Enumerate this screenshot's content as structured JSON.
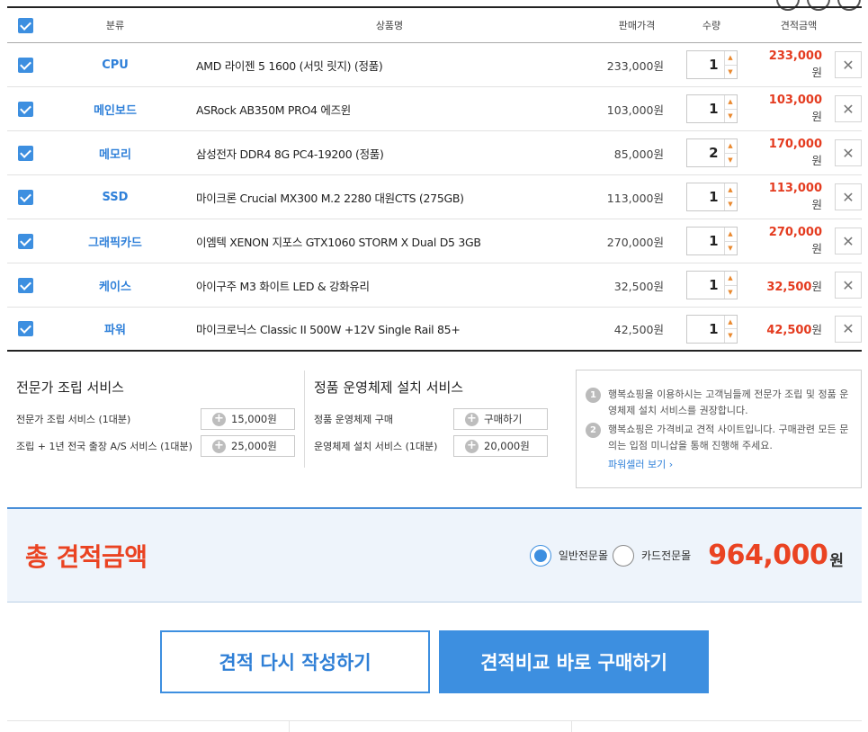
{
  "headers": {
    "category": "분류",
    "name": "상품명",
    "price": "판매가격",
    "qty": "수량",
    "total": "견적금액"
  },
  "items": [
    {
      "category": "CPU",
      "name": "AMD 라이젠 5 1600 (서밋 릿지) (정품)",
      "price": "233,000원",
      "qty": "1",
      "total": "233,000",
      "unit": "원"
    },
    {
      "category": "메인보드",
      "name": "ASRock AB350M PRO4 에즈윈",
      "price": "103,000원",
      "qty": "1",
      "total": "103,000",
      "unit": "원"
    },
    {
      "category": "메모리",
      "name": "삼성전자 DDR4 8G PC4-19200 (정품)",
      "price": "85,000원",
      "qty": "2",
      "total": "170,000",
      "unit": "원"
    },
    {
      "category": "SSD",
      "name": "마이크론 Crucial MX300 M.2 2280 대원CTS (275GB)",
      "price": "113,000원",
      "qty": "1",
      "total": "113,000",
      "unit": "원"
    },
    {
      "category": "그래픽카드",
      "name": "이엠텍 XENON 지포스 GTX1060 STORM X Dual D5 3GB",
      "price": "270,000원",
      "qty": "1",
      "total": "270,000",
      "unit": "원"
    },
    {
      "category": "케이스",
      "name": "아이구주 M3 화이트 LED & 강화유리",
      "price": "32,500원",
      "qty": "1",
      "total": "32,500",
      "unit": "원"
    },
    {
      "category": "파워",
      "name": "마이크로닉스 Classic II 500W +12V Single Rail 85+",
      "price": "42,500원",
      "qty": "1",
      "total": "42,500",
      "unit": "원"
    }
  ],
  "assembly": {
    "title": "전문가 조립 서비스",
    "rows": [
      {
        "label": "전문가 조립 서비스 (1대분)",
        "button": "15,000원"
      },
      {
        "label": "조립 + 1년 전국 출장 A/S 서비스 (1대분)",
        "button": "25,000원"
      }
    ]
  },
  "os": {
    "title": "정품 운영체제 설치 서비스",
    "rows": [
      {
        "label": "정품 운영체제 구매",
        "button": "구매하기"
      },
      {
        "label": "운영체제 설치 서비스 (1대분)",
        "button": "20,000원"
      }
    ]
  },
  "notice": {
    "items": [
      {
        "num": "1",
        "text": "행복쇼핑을 이용하시는 고객님들께 전문가 조립 및 정품 운영체제 설치 서비스를 권장합니다."
      },
      {
        "num": "2",
        "text": "행복쇼핑은 가격비교 견적 사이트입니다. 구매관련 모든 문의는 입점 미니샵을 통해 진행해 주세요."
      }
    ],
    "link": "파워셀러 보기 ›"
  },
  "summary": {
    "title": "총 견적금액",
    "option1": "일반전문몰",
    "option2": "카드전문몰",
    "selected": "일반전문몰",
    "amount": "964,000",
    "unit": "원"
  },
  "buttons": {
    "reset": "견적 다시 작성하기",
    "buy": "견적비교 바로 구매하기"
  },
  "colors": {
    "accent": "#3d8fe0",
    "price_red": "#e43b1f",
    "total_red": "#ea4322"
  },
  "icons": {
    "checkbox": "checkbox-checked-icon",
    "delete": "close-icon",
    "plus": "plus-circle-icon"
  }
}
